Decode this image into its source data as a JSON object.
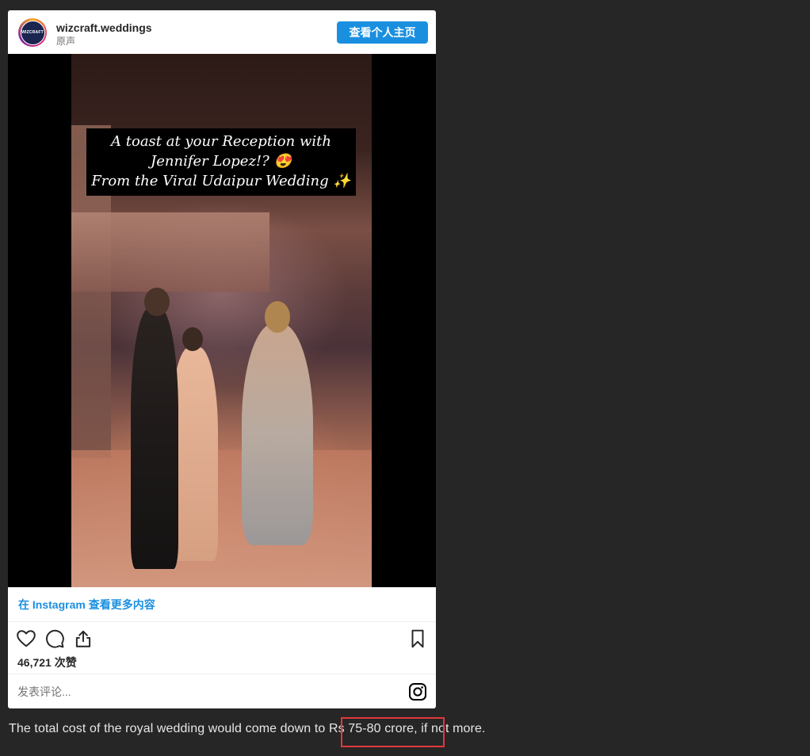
{
  "post": {
    "username": "wizcraft.weddings",
    "subtitle": "原声",
    "avatar_text": "WIZCRAFT",
    "profile_button": "查看个人主页",
    "video_caption": {
      "line1": "A toast at your Reception with",
      "line2": "Jennifer Lopez!? 😍",
      "line3": "From the Viral Udaipur Wedding ✨"
    },
    "view_more_link": "在 Instagram 查看更多内容",
    "likes_text": "46,721 次赞",
    "comment_placeholder": "发表评论..."
  },
  "article": {
    "sentence": "The total cost of the royal wedding would come down to Rs 75-80 crore, if not more.",
    "highlighted_phrase": "Rs 75-80 crore,"
  },
  "colors": {
    "page_background": "#262626",
    "link_blue": "#1a8fe0",
    "highlight_red": "#e0393e"
  },
  "icons": [
    "heart-icon",
    "comment-icon",
    "share-icon",
    "bookmark-icon",
    "instagram-icon"
  ]
}
